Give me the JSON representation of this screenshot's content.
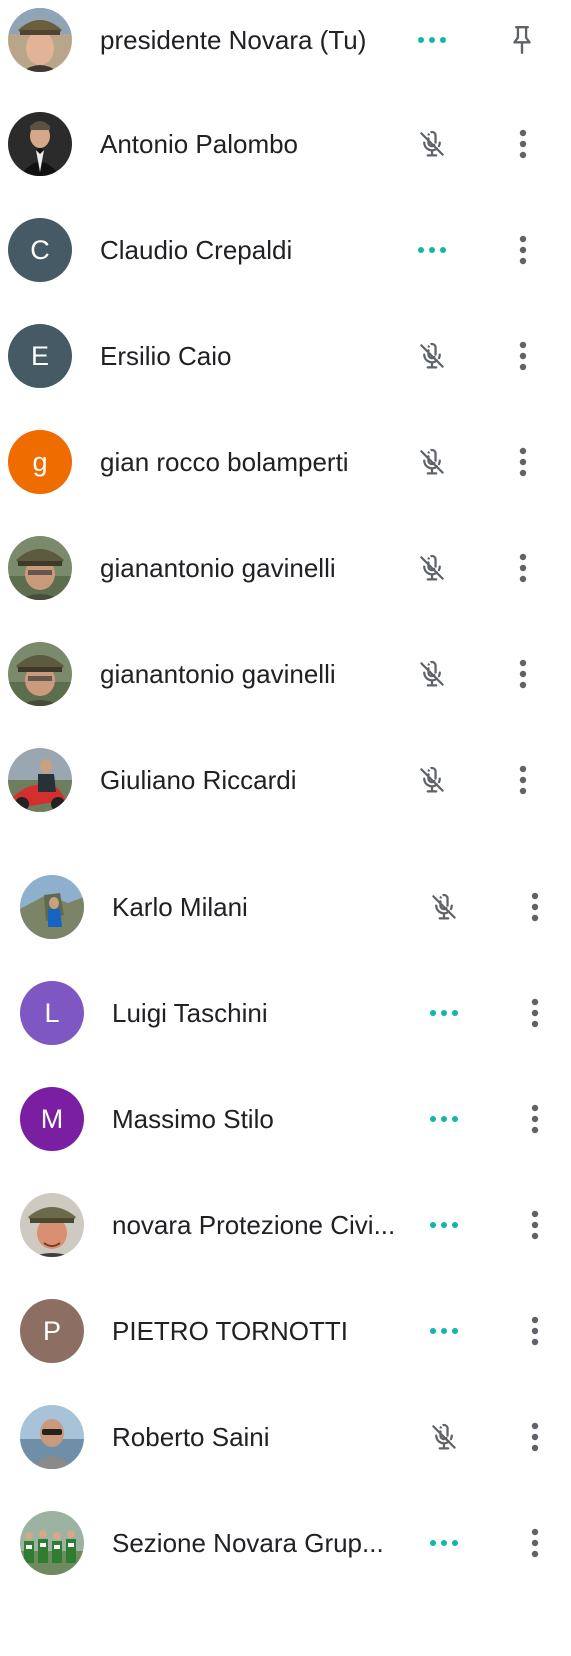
{
  "participants": [
    {
      "name": "presidente Novara (Tu)",
      "avatar": {
        "type": "photo",
        "photo": "man-with-alpine-hat"
      },
      "status": "speaking-dots-icon",
      "action": "pin-icon"
    },
    {
      "name": "Antonio Palombo",
      "avatar": {
        "type": "photo",
        "photo": "man-in-tuxedo"
      },
      "status": "mic-off-icon",
      "action": "more-vert-icon"
    },
    {
      "name": "Claudio Crepaldi",
      "avatar": {
        "type": "letter",
        "letter": "C",
        "color": "#455a64"
      },
      "status": "speaking-dots-icon",
      "action": "more-vert-icon"
    },
    {
      "name": "Ersilio Caio",
      "avatar": {
        "type": "letter",
        "letter": "E",
        "color": "#455a64"
      },
      "status": "mic-off-icon",
      "action": "more-vert-icon"
    },
    {
      "name": "gian rocco bolamperti",
      "avatar": {
        "type": "letter",
        "letter": "g",
        "color": "#ef6c00"
      },
      "status": "mic-off-icon",
      "action": "more-vert-icon"
    },
    {
      "name": "gianantonio gavinelli",
      "avatar": {
        "type": "photo",
        "photo": "man-with-alpine-hat-outdoor"
      },
      "status": "mic-off-icon",
      "action": "more-vert-icon"
    },
    {
      "name": "gianantonio gavinelli",
      "avatar": {
        "type": "photo",
        "photo": "man-with-alpine-hat-outdoor"
      },
      "status": "mic-off-icon",
      "action": "more-vert-icon"
    },
    {
      "name": "Giuliano Riccardi",
      "avatar": {
        "type": "photo",
        "photo": "man-with-red-motorcycle"
      },
      "status": "mic-off-icon",
      "action": "more-vert-icon"
    },
    {
      "name": "Karlo Milani",
      "avatar": {
        "type": "photo",
        "photo": "climber-on-rock"
      },
      "status": "mic-off-icon",
      "action": "more-vert-icon"
    },
    {
      "name": "Luigi Taschini",
      "avatar": {
        "type": "letter",
        "letter": "L",
        "color": "#7e57c2"
      },
      "status": "speaking-dots-icon",
      "action": "more-vert-icon"
    },
    {
      "name": "Massimo Stilo",
      "avatar": {
        "type": "letter",
        "letter": "M",
        "color": "#7b1fa2"
      },
      "status": "speaking-dots-icon",
      "action": "more-vert-icon"
    },
    {
      "name": "novara Protezione Civi...",
      "avatar": {
        "type": "photo",
        "photo": "man-with-hat-red-face"
      },
      "status": "speaking-dots-icon",
      "action": "more-vert-icon"
    },
    {
      "name": "PIETRO TORNOTTI",
      "avatar": {
        "type": "letter",
        "letter": "P",
        "color": "#8d6e63"
      },
      "status": "speaking-dots-icon",
      "action": "more-vert-icon"
    },
    {
      "name": "Roberto Saini",
      "avatar": {
        "type": "photo",
        "photo": "man-with-sunglasses-lake"
      },
      "status": "mic-off-icon",
      "action": "more-vert-icon"
    },
    {
      "name": "Sezione Novara Grup...",
      "avatar": {
        "type": "photo",
        "photo": "group-of-volunteers"
      },
      "status": "speaking-dots-icon",
      "action": "more-vert-icon"
    }
  ],
  "colors": {
    "speaking": "#12b5a6",
    "icon": "#5f6368",
    "text": "#202124"
  }
}
